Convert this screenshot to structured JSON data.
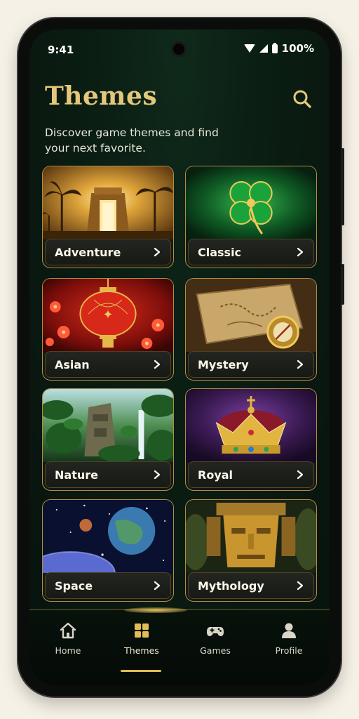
{
  "status_bar": {
    "time": "9:41",
    "battery": "100%"
  },
  "header": {
    "title": "Themes",
    "subtitle": "Discover game themes and find your next favorite."
  },
  "themes": [
    {
      "label": "Adventure"
    },
    {
      "label": "Classic"
    },
    {
      "label": "Asian"
    },
    {
      "label": "Mystery"
    },
    {
      "label": "Nature"
    },
    {
      "label": "Royal"
    },
    {
      "label": "Space"
    },
    {
      "label": "Mythology"
    }
  ],
  "nav": {
    "items": [
      {
        "label": "Home",
        "icon": "home-icon"
      },
      {
        "label": "Themes",
        "icon": "grid-icon",
        "active": true
      },
      {
        "label": "Games",
        "icon": "gamepad-icon"
      },
      {
        "label": "Profile",
        "icon": "person-icon"
      }
    ]
  },
  "colors": {
    "accent": "#e5c77a",
    "card_border": "#b48b42",
    "background": "#0b1f14"
  }
}
